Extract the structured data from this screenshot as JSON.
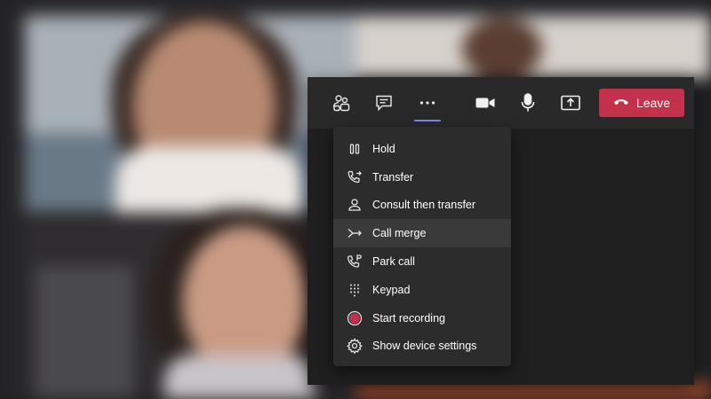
{
  "toolbar": {
    "participants_icon": "people-icon",
    "chat_icon": "chat-icon",
    "more_icon": "more-actions-icon",
    "camera_icon": "video-camera-icon",
    "mic_icon": "microphone-icon",
    "share_icon": "share-screen-icon",
    "leave_icon": "hang-up-icon",
    "leave_label": "Leave",
    "leave_color": "#c4314b",
    "accent_color": "#7f85f5"
  },
  "menu": {
    "items": [
      {
        "label": "Hold",
        "icon": "pause-icon"
      },
      {
        "label": "Transfer",
        "icon": "transfer-call-icon"
      },
      {
        "label": "Consult then transfer",
        "icon": "consult-icon"
      },
      {
        "label": "Call merge",
        "icon": "merge-icon",
        "highlighted": true
      },
      {
        "label": "Park call",
        "icon": "park-call-icon"
      },
      {
        "label": "Keypad",
        "icon": "keypad-icon"
      },
      {
        "label": "Start recording",
        "icon": "record-icon"
      },
      {
        "label": "Show device settings",
        "icon": "gear-icon"
      }
    ],
    "record_color": "#c4314b"
  }
}
